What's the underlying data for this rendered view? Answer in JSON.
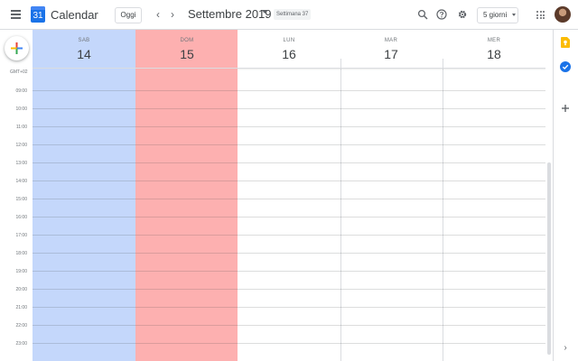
{
  "header": {
    "app_title": "Calendar",
    "logo_day": "31",
    "today_label": "Oggi",
    "prev_label": "‹",
    "next_label": "›",
    "month_title": "Settembre 2019",
    "week_label": "Settimana 37",
    "view_label": "5 giorni",
    "icons": [
      "menu-icon",
      "search-icon",
      "help-icon",
      "gear-icon",
      "apps-icon"
    ]
  },
  "timezone": "GMT+02",
  "days": [
    {
      "name": "SAB",
      "date": "14"
    },
    {
      "name": "DOM",
      "date": "15"
    },
    {
      "name": "LUN",
      "date": "16"
    },
    {
      "name": "MAR",
      "date": "17"
    },
    {
      "name": "MER",
      "date": "18"
    }
  ],
  "times": [
    "09:00",
    "10:00",
    "11:00",
    "12:00",
    "13:00",
    "14:00",
    "15:00",
    "16:00",
    "17:00",
    "18:00",
    "19:00",
    "20:00",
    "21:00",
    "22:00",
    "23:00"
  ],
  "colors": {
    "saturday": "#c4d7fb",
    "sunday": "#fdb0b0",
    "accent": "#1a73e8"
  },
  "side_panel": {
    "icons": [
      "keep-icon",
      "tasks-icon",
      "add-addon-icon",
      "expand-icon"
    ],
    "expand_label": "›"
  }
}
